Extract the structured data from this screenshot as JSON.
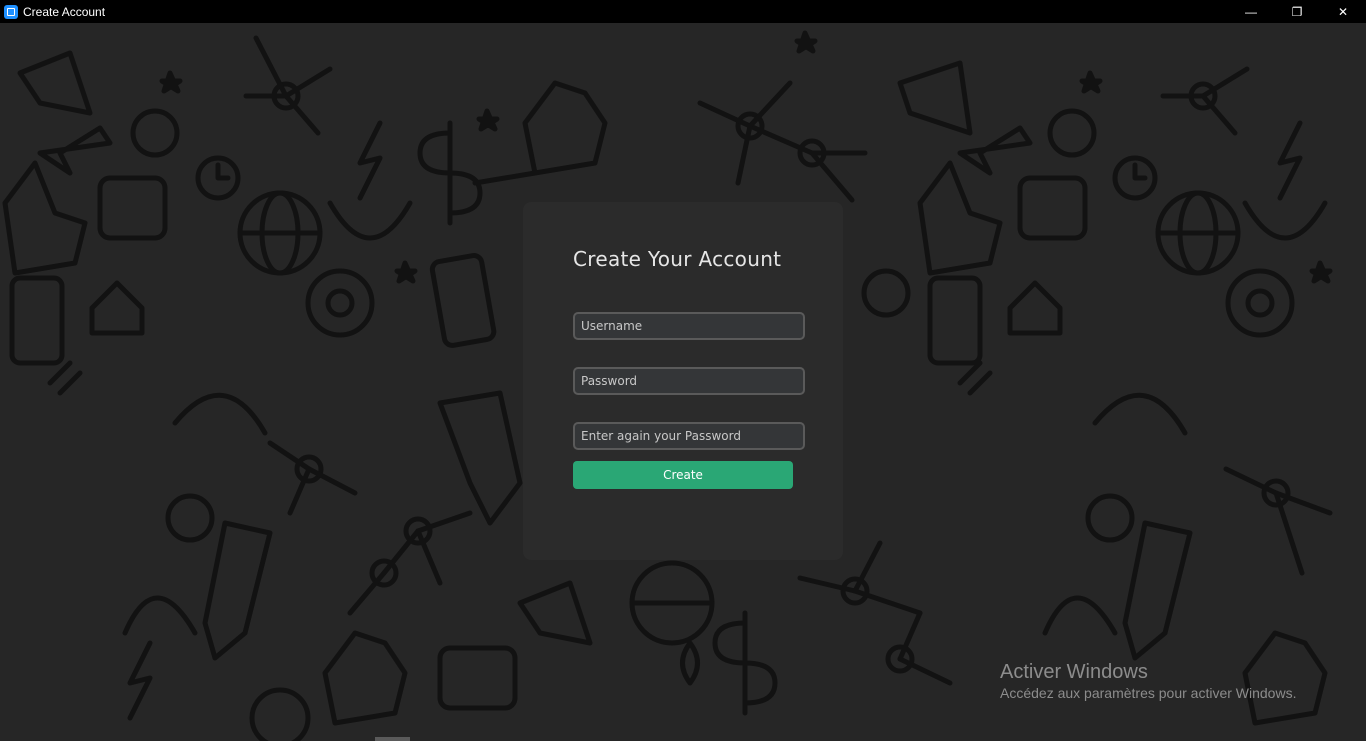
{
  "window": {
    "title": "Create Account",
    "controls": {
      "minimize_glyph": "—",
      "restore_glyph": "❐",
      "close_glyph": "✕"
    }
  },
  "form": {
    "heading": "Create Your Account",
    "username": {
      "placeholder": "Username",
      "value": ""
    },
    "password": {
      "placeholder": "Password",
      "value": ""
    },
    "password_confirm": {
      "placeholder": "Enter again your Password",
      "value": ""
    },
    "submit_label": "Create"
  },
  "watermark": {
    "title": "Activer Windows",
    "subtitle": "Accédez aux paramètres pour activer Windows."
  },
  "colors": {
    "background": "#262626",
    "card": "#2b2b2b",
    "accent": "#2aa775",
    "doodle": "#111111"
  }
}
